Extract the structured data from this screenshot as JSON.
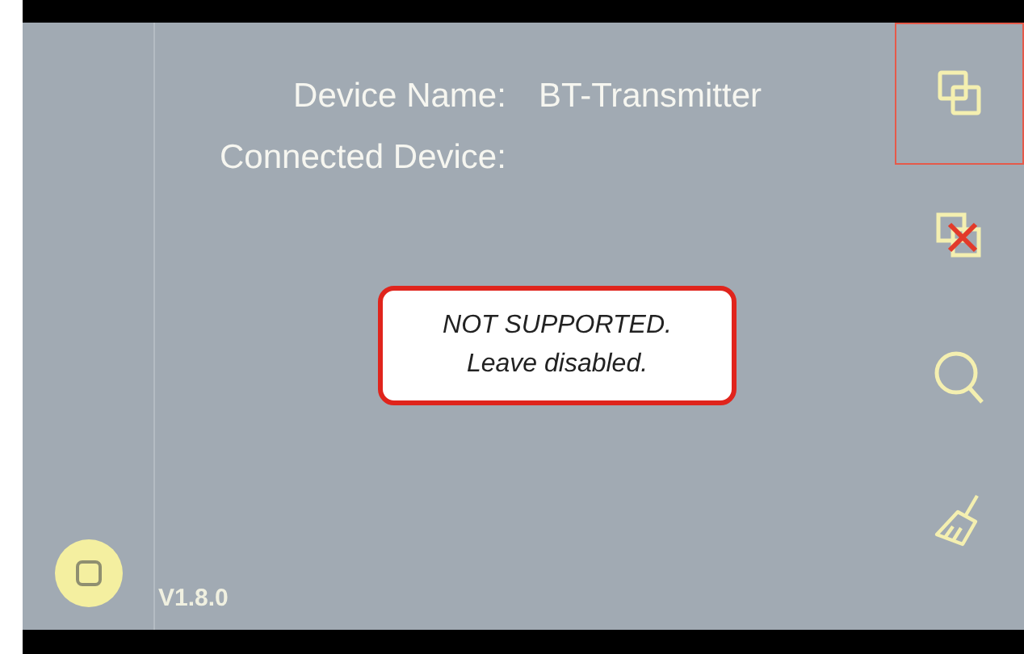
{
  "info": {
    "device_name_label": "Device Name:",
    "device_name_value": "BT-Transmitter",
    "connected_device_label": "Connected Device:"
  },
  "callout": {
    "lines": [
      "NOT SUPPORTED.",
      "Leave disabled."
    ]
  },
  "sidebar": [
    {
      "kind": "pair",
      "selected": true
    },
    {
      "kind": "unpair",
      "selected": false
    },
    {
      "kind": "search",
      "selected": false
    },
    {
      "kind": "clear",
      "selected": false
    }
  ],
  "version": "V1.8.0"
}
